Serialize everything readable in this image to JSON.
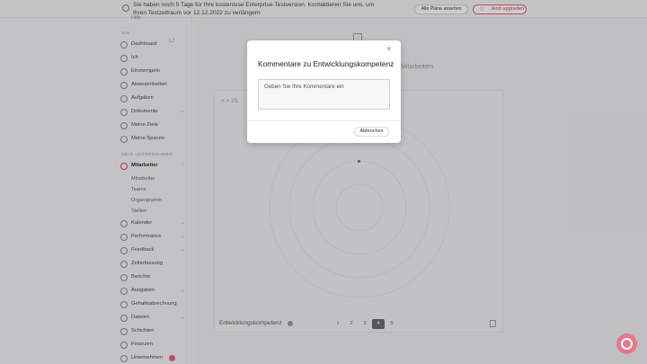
{
  "banner": {
    "text": "Sie haben noch 5 Tage für Ihre kostenlose Enterprise-Testversion. Kontaktieren Sie uns, um Ihren Testzeitraum vor 12.12.2022 zu verlängern",
    "plans_button": "Alle Pläne ansehen",
    "upgrade_button": "Jetzt upgraden",
    "upgrade_color": "#d83a5a"
  },
  "sidebar": {
    "hint": "Hilfe",
    "section_main": "ICH",
    "section_company": "MEIN UNTERNEHMEN",
    "main_items": [
      {
        "label": "Dashboard",
        "icon": "home-icon"
      },
      {
        "label": "Ich",
        "icon": "user-icon"
      },
      {
        "label": "Einstempeln",
        "icon": "clock-icon"
      },
      {
        "label": "Abwesenheiten",
        "icon": "calendar-icon"
      },
      {
        "label": "Aufgaben",
        "icon": "check-icon"
      },
      {
        "label": "Dokumente",
        "icon": "document-icon"
      },
      {
        "label": "Meine Ziele",
        "icon": "target-icon"
      },
      {
        "label": "Meine Spaces",
        "icon": "space-icon"
      }
    ],
    "company_active": "Mitarbeiter",
    "company_sub": [
      "Mitarbeiter",
      "Teams",
      "Organigramm",
      "Stellen"
    ],
    "company_items": [
      {
        "label": "Kalender",
        "icon": "calendar-icon"
      },
      {
        "label": "Performance",
        "icon": "chart-icon"
      },
      {
        "label": "Feedback",
        "icon": "chat-icon"
      },
      {
        "label": "Zeiterfassung",
        "icon": "clock-icon"
      },
      {
        "label": "Berichte",
        "icon": "report-icon"
      },
      {
        "label": "Ausgaben",
        "icon": "wallet-icon"
      },
      {
        "label": "Gehaltsabrechnung",
        "icon": "money-icon"
      },
      {
        "label": "Dateien",
        "icon": "folder-icon"
      },
      {
        "label": "Schichten",
        "icon": "shift-icon"
      },
      {
        "label": "Finanzen",
        "icon": "finance-icon"
      },
      {
        "label": "Unternehmen",
        "icon": "building-icon"
      }
    ]
  },
  "main": {
    "background_word": "Mitarbeiters",
    "nav_text": "< > 25.",
    "bottom_label": "Entwicklungskompetenz",
    "pages": [
      "1",
      "2",
      "3",
      "4",
      "5"
    ],
    "current_page": "4"
  },
  "modal": {
    "title": "Kommentare zu Entwicklungskompetenz",
    "placeholder": "Geben Sie Ihre Kommentare ein",
    "cancel": "Abbrechen",
    "close_icon": "×"
  }
}
